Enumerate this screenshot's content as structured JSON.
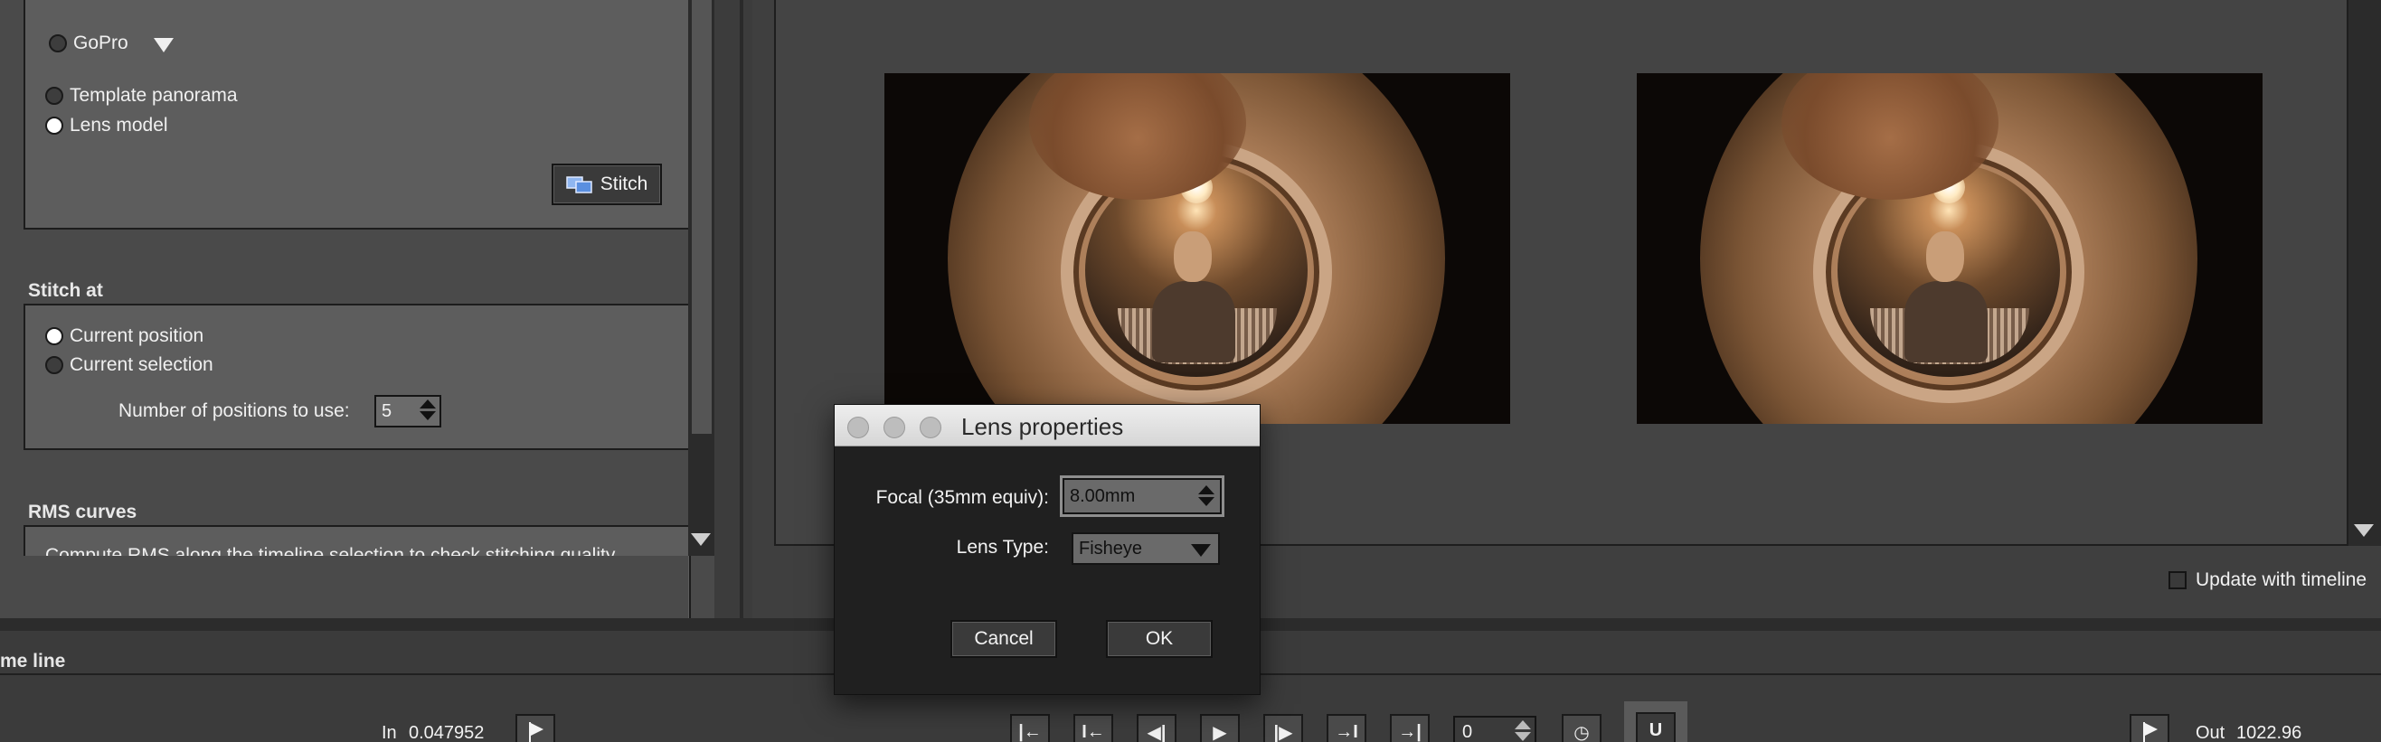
{
  "projection": {
    "camera_preset": "GoPro",
    "options": [
      {
        "label": "Template panorama",
        "selected": false
      },
      {
        "label": "Lens model",
        "selected": true
      }
    ],
    "stitch_button": "Stitch"
  },
  "stitch_at": {
    "title": "Stitch at",
    "options": [
      {
        "label": "Current position",
        "selected": true
      },
      {
        "label": "Current selection",
        "selected": false
      }
    ],
    "positions_label": "Number of positions to use:",
    "positions_value": "5"
  },
  "rms": {
    "title": "RMS curves",
    "description": "Compute RMS along the timeline selection to check stitching quality"
  },
  "preview": {
    "update_with_timeline_label": "Update with timeline",
    "update_with_timeline_checked": false
  },
  "timeline": {
    "title": "me line",
    "in_label": "In",
    "in_value": "0.047952",
    "out_label": "Out",
    "out_value": "1022.96",
    "frame_value": "0"
  },
  "dialog": {
    "title": "Lens properties",
    "focal_label": "Focal (35mm equiv):",
    "focal_value": "8.00mm",
    "lens_type_label": "Lens Type:",
    "lens_type_value": "Fisheye",
    "cancel_label": "Cancel",
    "ok_label": "OK"
  }
}
